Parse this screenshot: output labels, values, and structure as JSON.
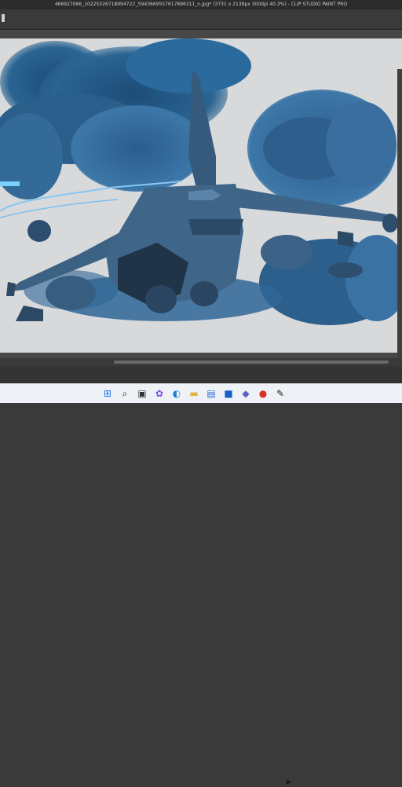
{
  "window": {
    "title": "466927066_1022532671899472ℤ_5943669557617896311_n.jpg* (3731 x 2138px 300dpi 40.3%)  - CLIP STUDIO PAINT PRO"
  },
  "canvas": {
    "image_subject": "",
    "colors": {
      "sky_light": "#d7d9db",
      "sky_blue": "#2a5a86",
      "sky_dark": "#1d3b57",
      "jet_body": "#3f6384",
      "jet_dark": "#1c2f42"
    }
  },
  "scrollbar": {
    "position": 0.3
  },
  "taskbar": {
    "icons": [
      {
        "name": "windows-start-icon",
        "glyph": "⊞"
      },
      {
        "name": "search-icon",
        "glyph": "⌕"
      },
      {
        "name": "task-view-icon",
        "glyph": "▣"
      },
      {
        "name": "copilot-icon",
        "glyph": "✿"
      },
      {
        "name": "edge-icon",
        "glyph": "◐"
      },
      {
        "name": "file-explorer-icon",
        "glyph": "▬"
      },
      {
        "name": "store-icon",
        "glyph": "▤"
      },
      {
        "name": "outlook-icon",
        "glyph": "■"
      },
      {
        "name": "teams-icon",
        "glyph": "◆"
      },
      {
        "name": "chrome-icon",
        "glyph": "●"
      },
      {
        "name": "clip-studio-icon",
        "glyph": "✎"
      }
    ]
  }
}
